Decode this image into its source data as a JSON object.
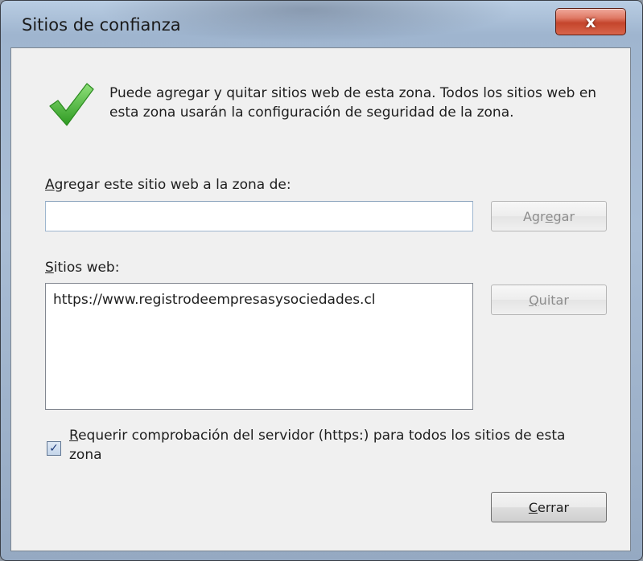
{
  "window": {
    "title": "Sitios de confianza",
    "close_glyph": "x"
  },
  "info": {
    "icon": "green-checkmark-icon",
    "text": "Puede agregar y quitar sitios web de esta zona. Todos los sitios web en esta zona usarán la configuración de seguridad de la zona."
  },
  "add": {
    "label_mnemonic": "A",
    "label_rest": "gregar este sitio web a la zona de:",
    "input_value": "",
    "button_pre": "Agr",
    "button_mnemonic": "e",
    "button_post": "gar"
  },
  "sites": {
    "label_mnemonic": "S",
    "label_rest": "itios web:",
    "items": [
      "https://www.registrodeempresasysociedades.cl"
    ],
    "remove_mnemonic": "Q",
    "remove_rest": "uitar"
  },
  "https_option": {
    "checked": true,
    "check_glyph": "✓",
    "label_mnemonic": "R",
    "label_rest": "equerir comprobación del servidor (https:) para todos los sitios de esta zona"
  },
  "close": {
    "mnemonic": "C",
    "rest": "errar"
  },
  "colors": {
    "check_green": "#3fae2c",
    "close_red": "#c4452c",
    "frame_blue": "#a9bdd5"
  }
}
